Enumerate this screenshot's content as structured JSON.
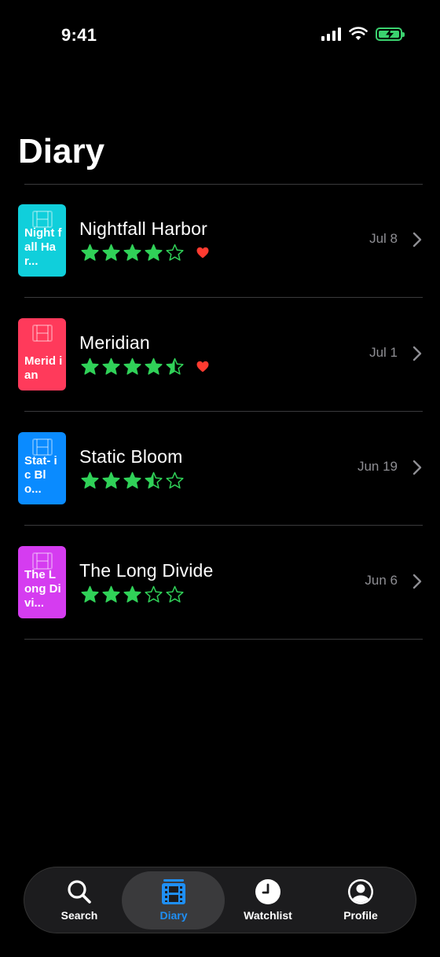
{
  "status_bar": {
    "time": "9:41"
  },
  "page_title": "Diary",
  "entries": [
    {
      "poster_text": "Night fall Har...",
      "poster_color": "#10cfdb",
      "title": "Nightfall Harbor",
      "rating": 4,
      "liked": true,
      "date": "Jul 8"
    },
    {
      "poster_text": "Merid ian",
      "poster_color": "#ff3a5b",
      "title": "Meridian",
      "rating": 4.5,
      "liked": true,
      "date": "Jul 1"
    },
    {
      "poster_text": "Stat- ic Blo...",
      "poster_color": "#0a8bff",
      "title": "Static Bloom",
      "rating": 3.5,
      "liked": false,
      "date": "Jun 19"
    },
    {
      "poster_text": "The Long Divi...",
      "poster_color": "#d53cf0",
      "title": "The Long Divide",
      "rating": 3,
      "liked": false,
      "date": "Jun 6"
    }
  ],
  "tabs": [
    {
      "label": "Search",
      "icon": "search-icon",
      "active": false
    },
    {
      "label": "Diary",
      "icon": "film-icon",
      "active": true
    },
    {
      "label": "Watchlist",
      "icon": "clock-icon",
      "active": false
    },
    {
      "label": "Profile",
      "icon": "person-icon",
      "active": false
    }
  ],
  "colors": {
    "star": "#30d158",
    "heart": "#ff3b30",
    "accent": "#1f8ff5",
    "date": "#8e8e93"
  }
}
